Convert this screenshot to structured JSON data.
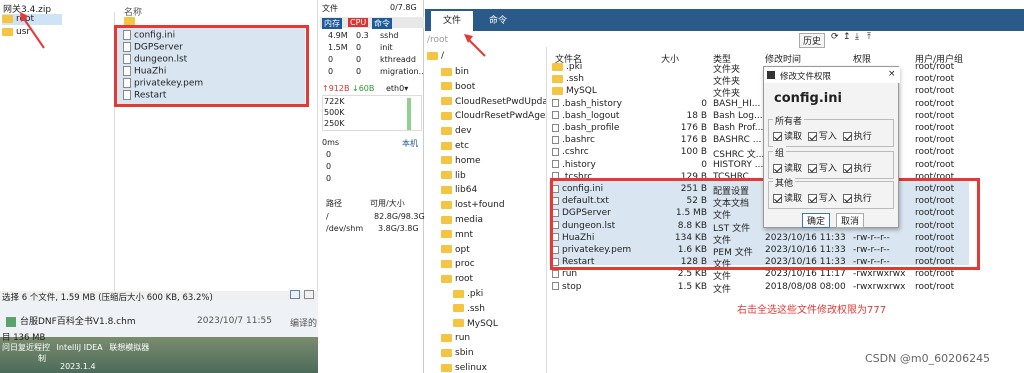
{
  "zip_panel": {
    "title": "网关3.4.zip",
    "folders": [
      "root",
      "usr"
    ],
    "name_header": "名称",
    "selected_files": [
      "config.ini",
      "DGPServer",
      "dungeon.lst",
      "HuaZhi",
      "privatekey.pem",
      "Restart"
    ],
    "status": "选择 6 个文件, 1.59 MB (压缩后大小 600 KB, 63.2%)"
  },
  "desktop": {
    "file_name": "台服DNF百科全书V1.8.chm",
    "file_date": "2023/10/7 11:55",
    "file_action": "编译的",
    "size_label": "目 136 MB",
    "taskbar_items": [
      "问日复近程控",
      "IntelliJ IDEA",
      "联想模拟器"
    ],
    "taskbar_sub": "制",
    "taskbar_ver": "2023.1.4"
  },
  "monitor": {
    "header": "文件",
    "mem_label": "内存",
    "cpu_label": "CPU",
    "cmd_label": "命令",
    "mem_total": "0/7.8G",
    "processes": [
      {
        "mem": "4.9M",
        "cpu": "0.3",
        "cmd": "sshd"
      },
      {
        "mem": "1.5M",
        "cpu": "0",
        "cmd": "init"
      },
      {
        "mem": "0",
        "cpu": "0",
        "cmd": "kthreadd"
      },
      {
        "mem": "0",
        "cpu": "0",
        "cmd": "migration.."
      }
    ],
    "net_up": "↑912B",
    "net_down": "↓60B",
    "iface": "eth0",
    "net_scale": [
      "722K",
      "500K",
      "250K"
    ],
    "latency": "0ms",
    "latency_host": "本机",
    "latency_vals": [
      "0",
      "0",
      "0"
    ],
    "disk_path": "路径",
    "disk_size": "可用/大小",
    "disks": [
      {
        "path": "/",
        "size": "82.8G/98.3G"
      },
      {
        "path": "/dev/shm",
        "size": "3.8G/3.8G"
      }
    ]
  },
  "tabs": [
    "文件",
    "命令"
  ],
  "path_input": "/root",
  "history_btn": "历史",
  "tree": {
    "root": "/",
    "items": [
      "bin",
      "boot",
      "CloudResetPwdUpda",
      "CloudrResetPwdAge",
      "dev",
      "etc",
      "home",
      "lib",
      "lib64",
      "lost+found",
      "media",
      "mnt",
      "opt",
      "proc",
      "root",
      ".pki",
      ".ssh",
      "MySQL",
      "run",
      "sbin",
      "selinux"
    ]
  },
  "columns": [
    "文件名",
    "大小",
    "类型",
    "修改时间",
    "权限",
    "用户/用户组"
  ],
  "files": [
    {
      "name": ".pki",
      "size": "",
      "type": "文件夹",
      "date": "",
      "perm": "",
      "owner": "root/root"
    },
    {
      "name": ".ssh",
      "size": "",
      "type": "文件夹",
      "date": "",
      "perm": "",
      "owner": "root/root"
    },
    {
      "name": "MySQL",
      "size": "",
      "type": "文件夹",
      "date": "",
      "perm": "",
      "owner": "root/root"
    },
    {
      "name": ".bash_history",
      "size": "0",
      "type": "BASH_HI...",
      "date": "",
      "perm": "",
      "owner": "root/root"
    },
    {
      "name": ".bash_logout",
      "size": "18 B",
      "type": "Bash Log...",
      "date": "",
      "perm": "",
      "owner": "root/root"
    },
    {
      "name": ".bash_profile",
      "size": "176 B",
      "type": "Bash Prof...",
      "date": "",
      "perm": "",
      "owner": "root/root"
    },
    {
      "name": ".bashrc",
      "size": "176 B",
      "type": "BASHRC ...",
      "date": "",
      "perm": "",
      "owner": "root/root"
    },
    {
      "name": ".cshrc",
      "size": "100 B",
      "type": "CSHRC 文...",
      "date": "",
      "perm": "",
      "owner": "root/root"
    },
    {
      "name": ".history",
      "size": "0",
      "type": "HISTORY ...",
      "date": "",
      "perm": "",
      "owner": "root/root"
    },
    {
      "name": ".tcshrc",
      "size": "129 B",
      "type": "TCSHRC ...",
      "date": "",
      "perm": "",
      "owner": "root/root"
    },
    {
      "name": "config.ini",
      "size": "251 B",
      "type": "配置设置",
      "date": "",
      "perm": "",
      "owner": "root/root"
    },
    {
      "name": "default.txt",
      "size": "52 B",
      "type": "文本文档",
      "date": "",
      "perm": "",
      "owner": "root/root"
    },
    {
      "name": "DGPServer",
      "size": "1.5 MB",
      "type": "文件",
      "date": "",
      "perm": "",
      "owner": "root/root"
    },
    {
      "name": "dungeon.lst",
      "size": "8.8 KB",
      "type": "LST 文件",
      "date": "",
      "perm": "",
      "owner": "root/root"
    },
    {
      "name": "HuaZhi",
      "size": "134 KB",
      "type": "文件",
      "date": "2023/10/16 11:33",
      "perm": "-rw-r--r--",
      "owner": "root/root"
    },
    {
      "name": "privatekey.pem",
      "size": "1.6 KB",
      "type": "PEM 文件",
      "date": "2023/10/16 11:33",
      "perm": "-rw-r--r--",
      "owner": "root/root"
    },
    {
      "name": "Restart",
      "size": "128 B",
      "type": "文件",
      "date": "2023/10/16 11:33",
      "perm": "-rw-r--r--",
      "owner": "root/root"
    },
    {
      "name": "run",
      "size": "2.5 KB",
      "type": "文件",
      "date": "2023/10/16 11:17",
      "perm": "-rwxrwxrwx",
      "owner": "root/root"
    },
    {
      "name": "stop",
      "size": "1.5 KB",
      "type": "文件",
      "date": "2018/08/08 08:00",
      "perm": "-rwxrwxrwx",
      "owner": "root/root"
    }
  ],
  "dialog": {
    "title": "修改文件权限",
    "filename": "config.ini",
    "groups": [
      {
        "label": "所有者",
        "opts": [
          "读取",
          "写入",
          "执行"
        ]
      },
      {
        "label": "组",
        "opts": [
          "读取",
          "写入",
          "执行"
        ]
      },
      {
        "label": "其他",
        "opts": [
          "读取",
          "写入",
          "执行"
        ]
      }
    ],
    "ok": "确定",
    "cancel": "取消"
  },
  "annotation": "右击全选这些文件修改权限为777",
  "watermark": "CSDN @m0_60206245",
  "colors": {
    "red": "#e53935",
    "selected": "#d9e6f2",
    "tab_bg": "#2a5a8a"
  }
}
